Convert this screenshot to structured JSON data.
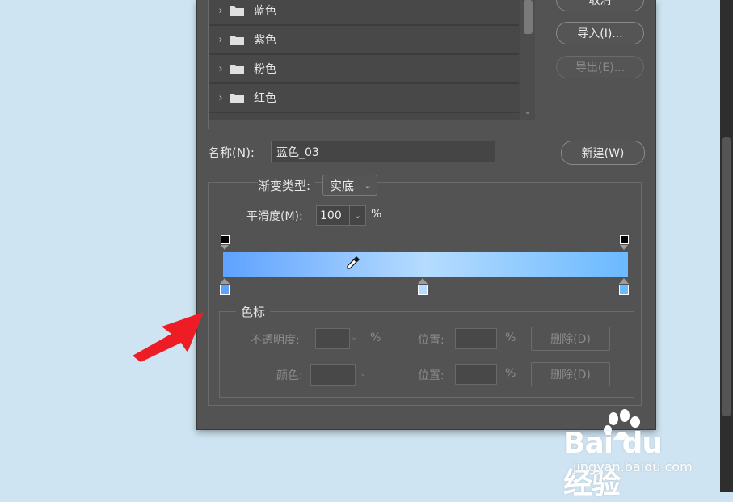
{
  "presets": {
    "items": [
      {
        "label": "蓝色"
      },
      {
        "label": "紫色"
      },
      {
        "label": "粉色"
      },
      {
        "label": "红色"
      }
    ]
  },
  "buttons": {
    "cancel": "取消",
    "import": "导入(I)...",
    "export": "导出(E)...",
    "new": "新建(W)"
  },
  "name": {
    "label": "名称(N):",
    "value": "蓝色_03"
  },
  "gradient": {
    "type_label": "渐变类型:",
    "type_value": "实底",
    "smoothness_label": "平滑度(M):",
    "smoothness_value": "100",
    "percent": "%",
    "colors": {
      "left": "#5ea2ff",
      "middle": "#b6dcff",
      "right": "#6bb9ff"
    }
  },
  "stops": {
    "group_label": "色标",
    "opacity_label": "不透明度:",
    "location_label": "位置:",
    "color_label": "颜色:",
    "percent": "%",
    "delete_label": "删除(D)"
  },
  "watermark": {
    "logo": "Bai du 经验",
    "url": "jingyan.baidu.com"
  }
}
